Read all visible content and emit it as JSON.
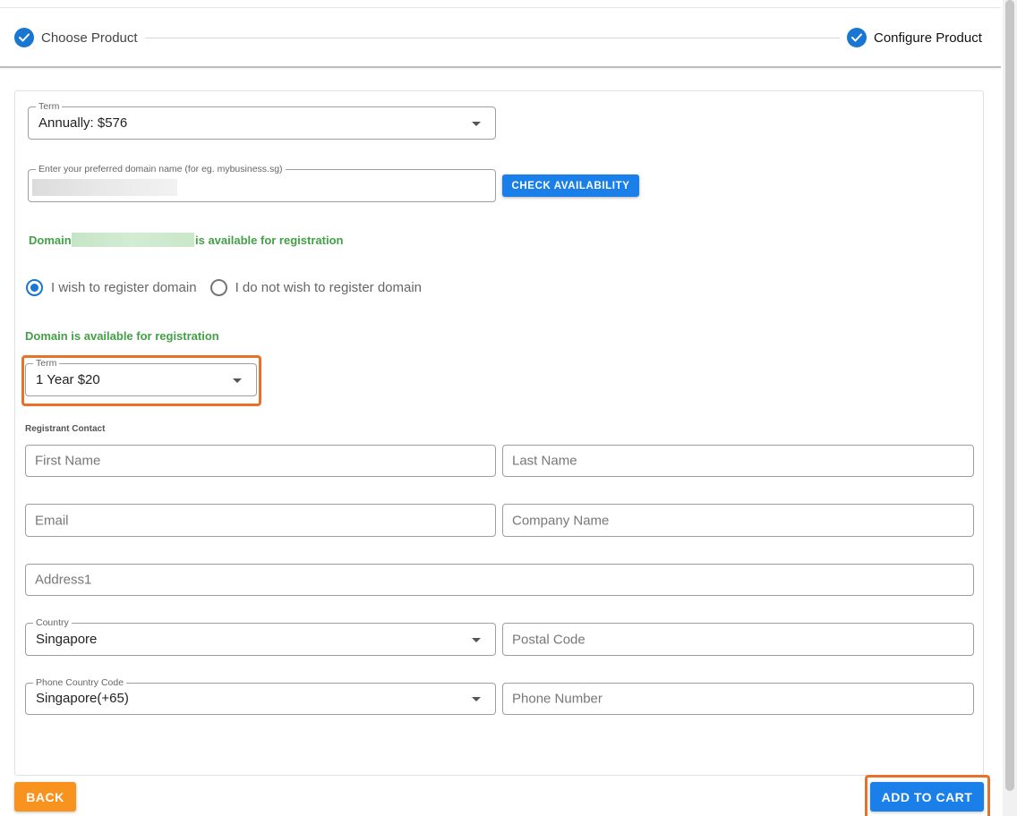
{
  "stepper": {
    "steps": [
      {
        "label": "Choose Product",
        "status": "completed",
        "icon": "check-icon"
      },
      {
        "label": "Configure Product",
        "status": "active",
        "icon": "check-icon"
      }
    ]
  },
  "form": {
    "term": {
      "legend": "Term",
      "value": "Annually: $576"
    },
    "domain": {
      "legend": "Enter your preferred domain name (for eg. mybusiness.sg)",
      "value": ""
    },
    "check_button": "CHECK AVAILABILITY",
    "availability_message": {
      "prefix": "Domain",
      "suffix": "is available for registration"
    },
    "radio_options": [
      {
        "label": "I wish to register domain",
        "checked": true
      },
      {
        "label": "I do not wish to register domain",
        "checked": false
      }
    ],
    "availability_message_2": "Domain is available for registration",
    "domain_term": {
      "legend": "Term",
      "value": "1 Year $20"
    },
    "registrant_label": "Registrant Contact",
    "first_name": {
      "placeholder": "First Name"
    },
    "last_name": {
      "placeholder": "Last Name"
    },
    "email": {
      "placeholder": "Email"
    },
    "company": {
      "placeholder": "Company Name"
    },
    "address1": {
      "placeholder": "Address1"
    },
    "country": {
      "legend": "Country",
      "value": "Singapore"
    },
    "postal_code": {
      "placeholder": "Postal Code"
    },
    "phone_country_code": {
      "legend": "Phone Country Code",
      "value": "Singapore(+65)"
    },
    "phone_number": {
      "placeholder": "Phone Number"
    }
  },
  "footer": {
    "back_label": "BACK",
    "add_to_cart_label": "ADD TO CART"
  },
  "colors": {
    "primary": "#1a7fe8",
    "success": "#43a047",
    "back_button": "#f7931e",
    "highlight": "#e8722c"
  }
}
